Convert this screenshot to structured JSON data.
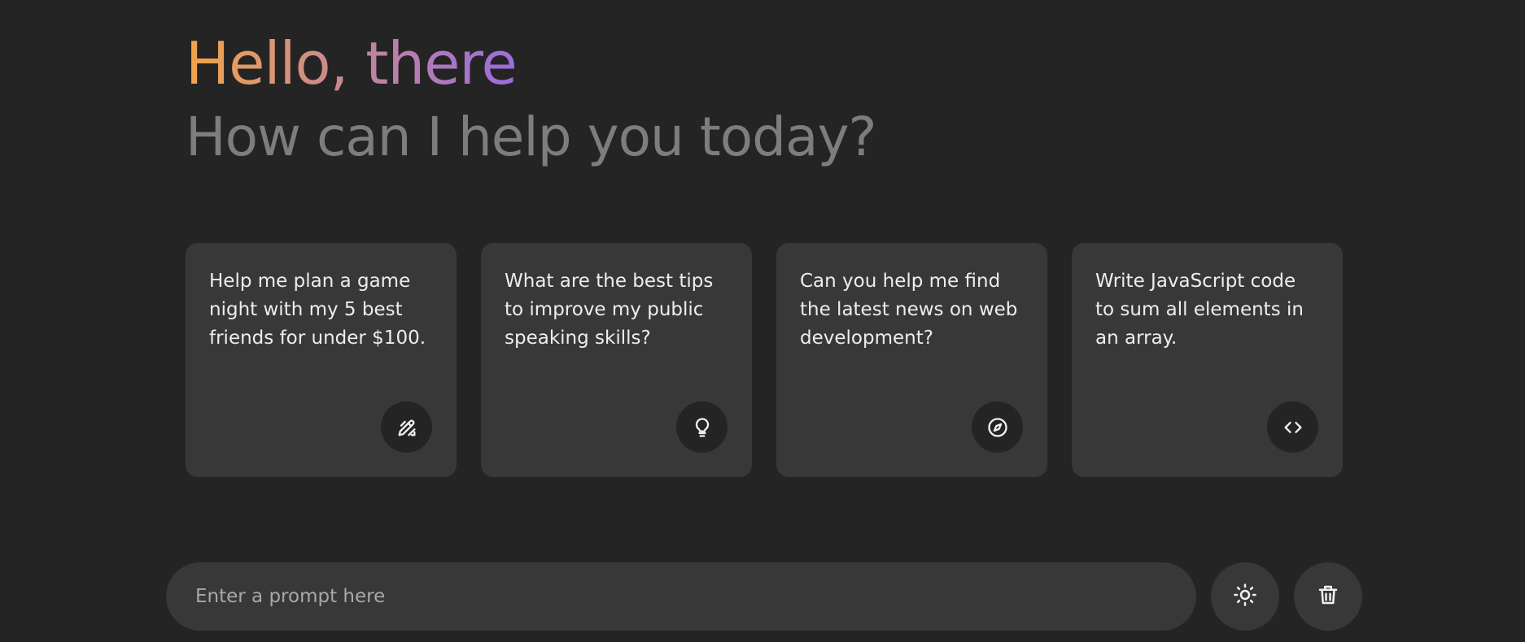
{
  "header": {
    "greeting": "Hello, there",
    "subtitle": "How can I help you today?"
  },
  "suggestions": [
    {
      "text": "Help me plan a game night with my 5 best friends for under $100.",
      "icon": "draw-icon"
    },
    {
      "text": "What are the best tips to improve my public speaking skills?",
      "icon": "lightbulb-icon"
    },
    {
      "text": "Can you help me find the latest news on web development?",
      "icon": "explore-icon"
    },
    {
      "text": "Write JavaScript code to sum all elements in an array.",
      "icon": "code-icon"
    }
  ],
  "prompt": {
    "placeholder": "Enter a prompt here",
    "value": ""
  },
  "actions": {
    "theme_icon": "light-mode-icon",
    "delete_icon": "delete-icon"
  },
  "colors": {
    "background": "#242424",
    "card": "#383838",
    "gradient_start": "#f2a54a",
    "gradient_end": "#9b6be0",
    "subtitle": "#7d7d7d"
  }
}
